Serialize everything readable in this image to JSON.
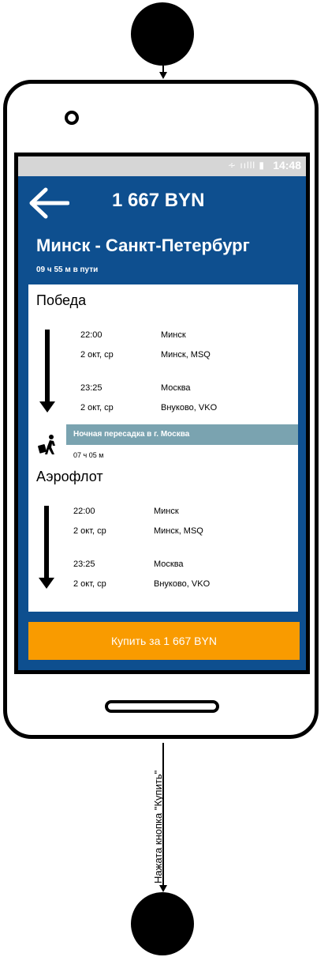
{
  "status": {
    "time": "14:48"
  },
  "header": {
    "price_title": "1 667 BYN"
  },
  "trip": {
    "route": "Минск - Санкт-Петербург",
    "duration": "09 ч 55 м в пути"
  },
  "segments": [
    {
      "airline": "Победа",
      "dep_time": "22:00",
      "dep_date": "2 окт, ср",
      "dep_city": "Минск",
      "dep_airport": "Минск, MSQ",
      "arr_time": "23:25",
      "arr_date": "2 окт, ср",
      "arr_city": "Москва",
      "arr_airport": "Внуково, VKO"
    },
    {
      "airline": "Аэрофлот",
      "dep_time": "22:00",
      "dep_date": "2 окт, ср",
      "dep_city": "Минск",
      "dep_airport": "Минск, MSQ",
      "arr_time": "23:25",
      "arr_date": "2 окт, ср",
      "arr_city": "Москва",
      "arr_airport": "Внуково, VKO"
    }
  ],
  "transfer": {
    "label": "Ночная пересадка в г. Москва",
    "duration": "07 ч 05 м"
  },
  "buy_button": {
    "label": "Купить за 1 667 BYN"
  },
  "edge_label": "Нажата кнопка \"Купить\""
}
